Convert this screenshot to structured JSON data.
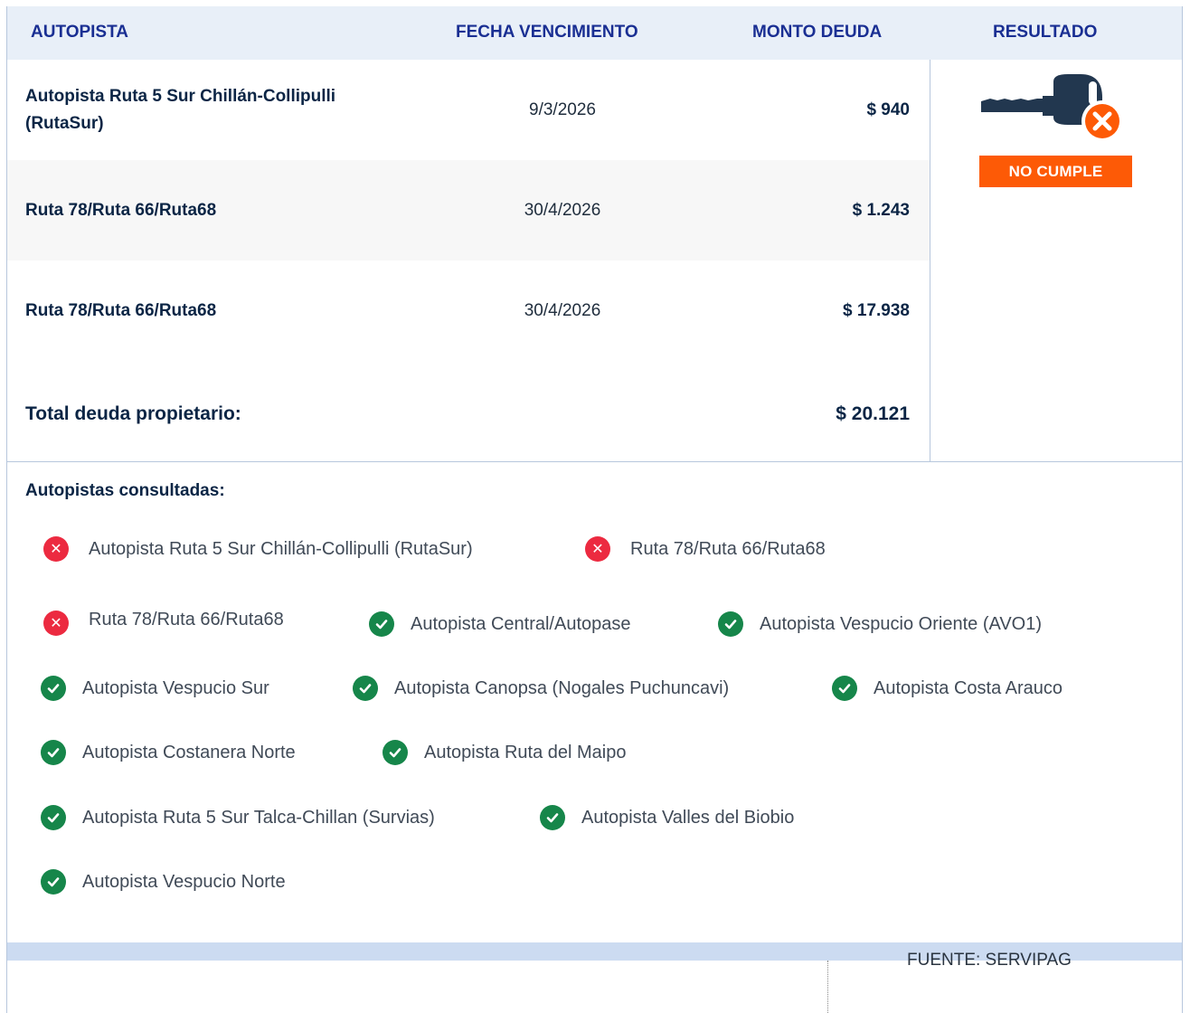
{
  "table": {
    "headers": {
      "autopista": "AUTOPISTA",
      "fecha": "FECHA VENCIMIENTO",
      "monto": "MONTO DEUDA",
      "resultado": "RESULTADO"
    },
    "rows": [
      {
        "autopista": "Autopista Ruta 5 Sur Chillán-Collipulli (RutaSur)",
        "fecha": "9/3/2026",
        "monto": "$ 940"
      },
      {
        "autopista": "Ruta 78/Ruta 66/Ruta68",
        "fecha": "30/4/2026",
        "monto": "$ 1.243"
      },
      {
        "autopista": "Ruta 78/Ruta 66/Ruta68",
        "fecha": "30/4/2026",
        "monto": "$ 17.938"
      }
    ],
    "total_label": "Total deuda propietario:",
    "total_value": "$ 20.121"
  },
  "result": {
    "badge": "NO CUMPLE",
    "icon": "key-with-x-icon",
    "badge_color": "#fd5a06"
  },
  "consulted": {
    "title": "Autopistas consultadas:",
    "items": [
      {
        "label": "Autopista Ruta 5 Sur Chillán-Collipulli (RutaSur)",
        "status": "fail"
      },
      {
        "label": "Ruta 78/Ruta 66/Ruta68",
        "status": "fail"
      },
      {
        "label": "Ruta 78/Ruta 66/Ruta68",
        "status": "fail"
      },
      {
        "label": "Autopista Central/Autopase",
        "status": "ok"
      },
      {
        "label": "Autopista Vespucio Oriente (AVO1)",
        "status": "ok"
      },
      {
        "label": "Autopista Vespucio Sur",
        "status": "ok"
      },
      {
        "label": "Autopista Canopsa (Nogales Puchuncavi)",
        "status": "ok"
      },
      {
        "label": "Autopista Costa Arauco",
        "status": "ok"
      },
      {
        "label": "Autopista Costanera Norte",
        "status": "ok"
      },
      {
        "label": "Autopista Ruta del Maipo",
        "status": "ok"
      },
      {
        "label": "Autopista Ruta 5 Sur Talca-Chillan (Survias)",
        "status": "ok"
      },
      {
        "label": "Autopista Valles del Biobio",
        "status": "ok"
      },
      {
        "label": "Autopista Vespucio Norte",
        "status": "ok"
      }
    ]
  },
  "footer": {
    "source": "FUENTE: SERVIPAG"
  },
  "colors": {
    "header_bg": "#e8eff8",
    "header_text": "#1a2f93",
    "ok": "#16864a",
    "fail": "#ec2a40"
  }
}
